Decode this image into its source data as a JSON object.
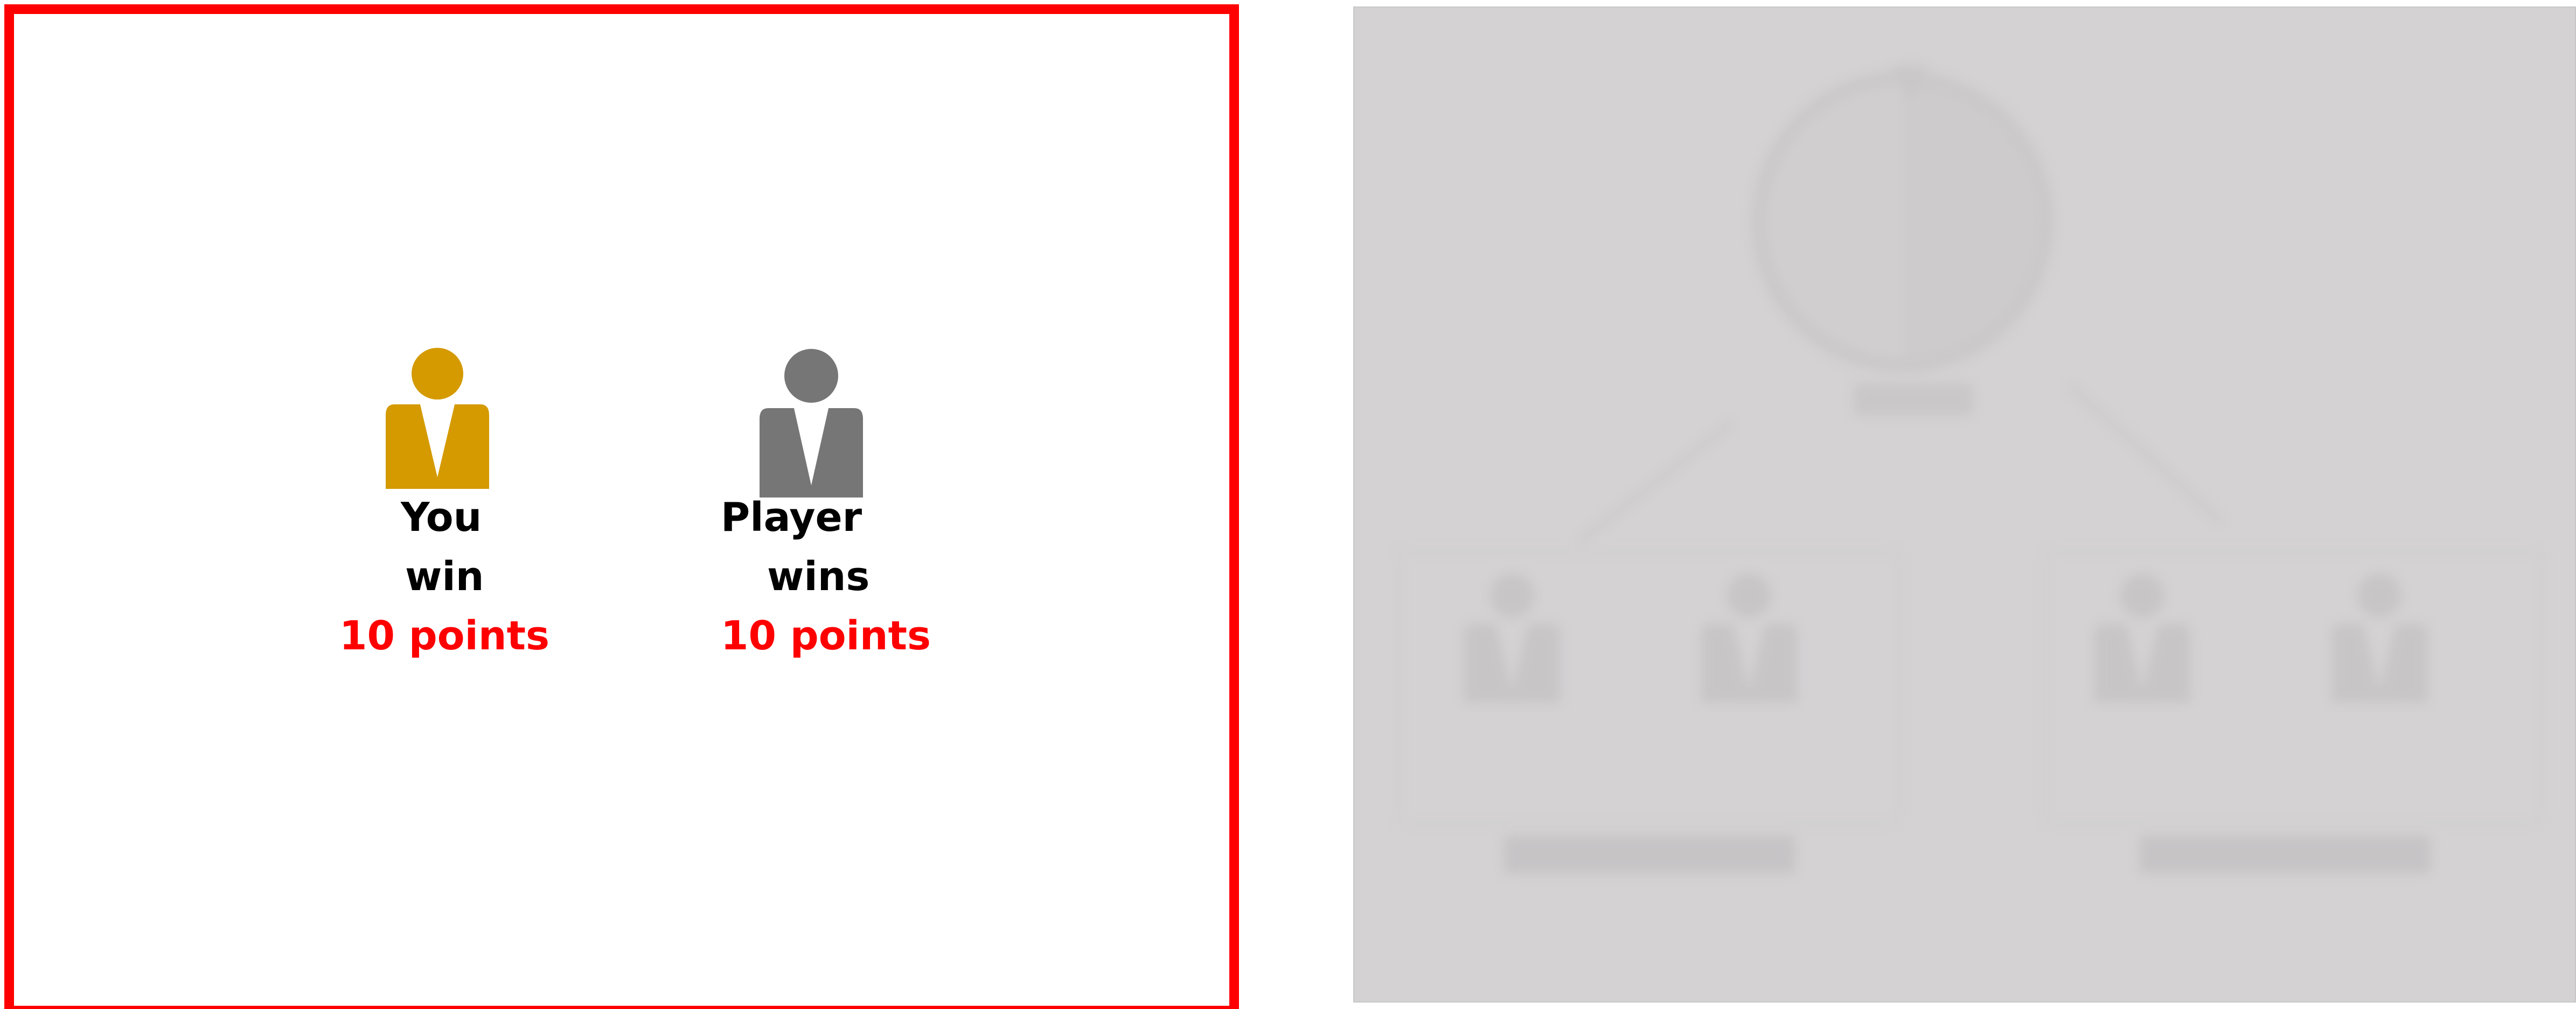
{
  "left_panel": {
    "border_color": "#ff0000",
    "you": {
      "icon": "person-icon",
      "icon_color": "#d49a00",
      "line1": "You",
      "line2": "win",
      "points": "10 points"
    },
    "player": {
      "icon": "person-icon",
      "icon_color": "#767676",
      "line1": "Player",
      "line2": "wins",
      "points": "10 points"
    }
  },
  "right_panel": {
    "background": "#d4d2d3"
  }
}
